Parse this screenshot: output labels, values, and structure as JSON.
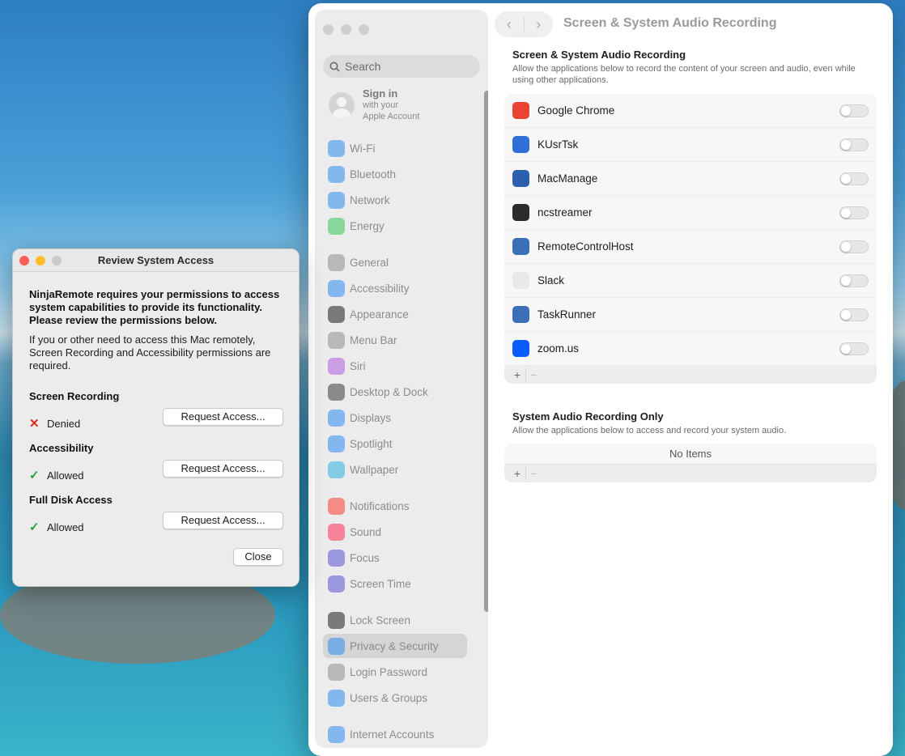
{
  "settings": {
    "window_title": "Screen & System Audio Recording",
    "search_placeholder": "Search",
    "account": {
      "title": "Sign in",
      "line1": "with your",
      "line2": "Apple Account"
    },
    "sidebar_items": [
      {
        "label": "Wi-Fi",
        "icon": "wifi-icon",
        "color": "#2f8cf0"
      },
      {
        "label": "Bluetooth",
        "icon": "bluetooth-icon",
        "color": "#2f8cf0"
      },
      {
        "label": "Network",
        "icon": "globe-icon",
        "color": "#2f8cf0"
      },
      {
        "label": "Energy",
        "icon": "bolt-icon",
        "color": "#35c759"
      },
      {
        "label": "General",
        "icon": "gear-icon",
        "color": "#8e8e93"
      },
      {
        "label": "Accessibility",
        "icon": "accessibility-icon",
        "color": "#2f8cf0"
      },
      {
        "label": "Appearance",
        "icon": "appearance-icon",
        "color": "#1d1d1d"
      },
      {
        "label": "Menu Bar",
        "icon": "menubar-icon",
        "color": "#8e8e93"
      },
      {
        "label": "Siri",
        "icon": "siri-icon",
        "color": "#b05ce0"
      },
      {
        "label": "Desktop & Dock",
        "icon": "dock-icon",
        "color": "#3a3a3c"
      },
      {
        "label": "Displays",
        "icon": "displays-icon",
        "color": "#2f8cf0"
      },
      {
        "label": "Spotlight",
        "icon": "spotlight-icon",
        "color": "#2f8cf0"
      },
      {
        "label": "Wallpaper",
        "icon": "wallpaper-icon",
        "color": "#2fb3e0"
      },
      {
        "label": "Notifications",
        "icon": "bell-icon",
        "color": "#ff3b30"
      },
      {
        "label": "Sound",
        "icon": "speaker-icon",
        "color": "#ff2d55"
      },
      {
        "label": "Focus",
        "icon": "moon-icon",
        "color": "#5856d6"
      },
      {
        "label": "Screen Time",
        "icon": "hourglass-icon",
        "color": "#5856d6"
      },
      {
        "label": "Lock Screen",
        "icon": "lock-icon",
        "color": "#1d1d1d"
      },
      {
        "label": "Privacy & Security",
        "icon": "hand-icon",
        "color": "#2f8cf0"
      },
      {
        "label": "Login Password",
        "icon": "lock-icon",
        "color": "#8e8e93"
      },
      {
        "label": "Users & Groups",
        "icon": "users-icon",
        "color": "#2f8cf0"
      },
      {
        "label": "Internet Accounts",
        "icon": "at-icon",
        "color": "#2f8cf0"
      }
    ],
    "section1": {
      "title": "Screen & System Audio Recording",
      "description": "Allow the applications below to record the content of your screen and audio, even while using other applications.",
      "apps": [
        {
          "name": "Google Chrome",
          "icon": "chrome-icon",
          "color": "#ea4335"
        },
        {
          "name": "KUsrTsk",
          "icon": "kusrtsk-icon",
          "color": "#2f6fd6"
        },
        {
          "name": "MacManage",
          "icon": "macmanage-icon",
          "color": "#2a5fb0"
        },
        {
          "name": "ncstreamer",
          "icon": "ncstreamer-icon",
          "color": "#2b2b2b"
        },
        {
          "name": "RemoteControlHost",
          "icon": "remote-icon",
          "color": "#3b6fb8"
        },
        {
          "name": "Slack",
          "icon": "slack-icon",
          "color": "#e9e9e9"
        },
        {
          "name": "TaskRunner",
          "icon": "taskrunner-icon",
          "color": "#3b6fb8"
        },
        {
          "name": "zoom.us",
          "icon": "zoom-icon",
          "color": "#0b5cff"
        }
      ],
      "add": "+",
      "remove": "−"
    },
    "section2": {
      "title": "System Audio Recording Only",
      "description": "Allow the applications below to access and record your system audio.",
      "empty": "No Items",
      "add": "+",
      "remove": "−"
    }
  },
  "dialog": {
    "title": "Review System Access",
    "intro": "NinjaRemote requires your permissions to access system capabilities to provide its functionality. Please review the permissions below.",
    "note": "If you or other need to access this Mac remotely, Screen Recording and Accessibility permissions are required.",
    "permissions": [
      {
        "heading": "Screen Recording",
        "status": "Denied",
        "mark": "✕",
        "mark_color": "#e0251b",
        "button": "Request Access..."
      },
      {
        "heading": "Accessibility",
        "status": "Allowed",
        "mark": "✓",
        "mark_color": "#2a9d3a",
        "button": "Request Access..."
      },
      {
        "heading": "Full Disk Access",
        "status": "Allowed",
        "mark": "✓",
        "mark_color": "#2a9d3a",
        "button": "Request Access..."
      }
    ],
    "close": "Close"
  }
}
